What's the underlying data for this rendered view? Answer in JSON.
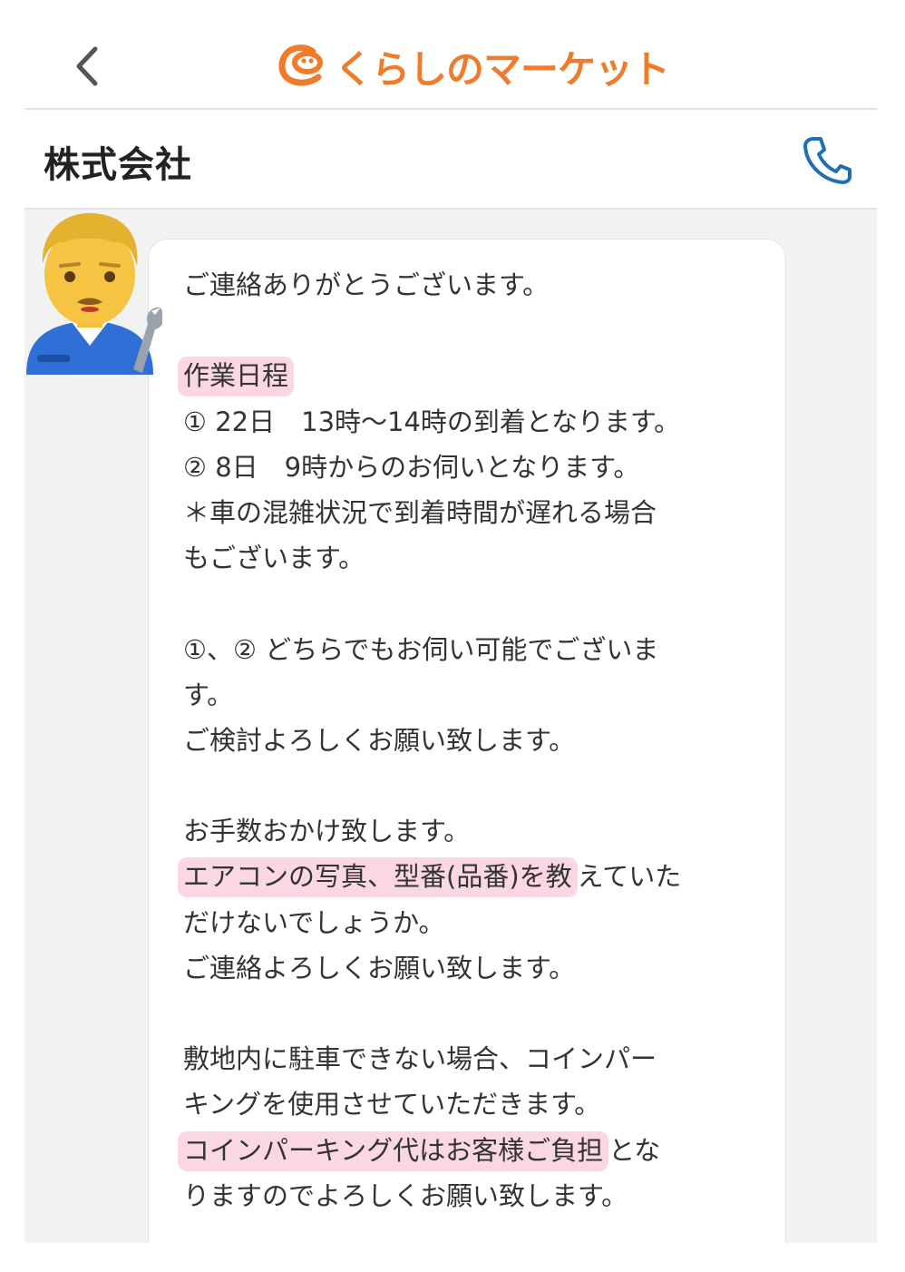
{
  "header": {
    "back_label": "<",
    "logo_text": "くらしのマーケット",
    "logo_icon": "kurashi-market-logo-icon",
    "brand_color": "#f07b2a"
  },
  "subheader": {
    "company_name": "株式会社",
    "phone_icon": "phone-icon",
    "phone_color": "#1e6fb3"
  },
  "message": {
    "avatar_icon": "man-mechanic-emoji",
    "highlight_color": "#fbd7e6",
    "lines": [
      "ご連絡ありがとうございます。",
      "",
      "作業日程",
      "① 22日　13時〜14時の到着となります。",
      "② 8日　9時からのお伺いとなります。",
      "＊車の混雑状況で到着時間が遅れる場合",
      "もございます。",
      "",
      "①、② どちらでもお伺い可能でございま",
      "す。",
      "ご検討よろしくお願い致します。",
      "",
      "お手数おかけ致します。",
      "エアコンの写真、型番(品番)を教えていた",
      "だけないでしょうか。",
      "ご連絡よろしくお願い致します。",
      "",
      "敷地内に駐車できない場合、コインパー",
      "キングを使用させていただきます。",
      "コインパーキング代はお客様ご負担とな",
      "りますのでよろしくお願い致します。"
    ],
    "highlights": {
      "h2": "作業日程",
      "h13a": "エアコンの写真、型番(品番)を教",
      "h13b": "えていた",
      "h19a": "コインパーキング代はお客様ご負担",
      "h19b": "とな"
    }
  }
}
